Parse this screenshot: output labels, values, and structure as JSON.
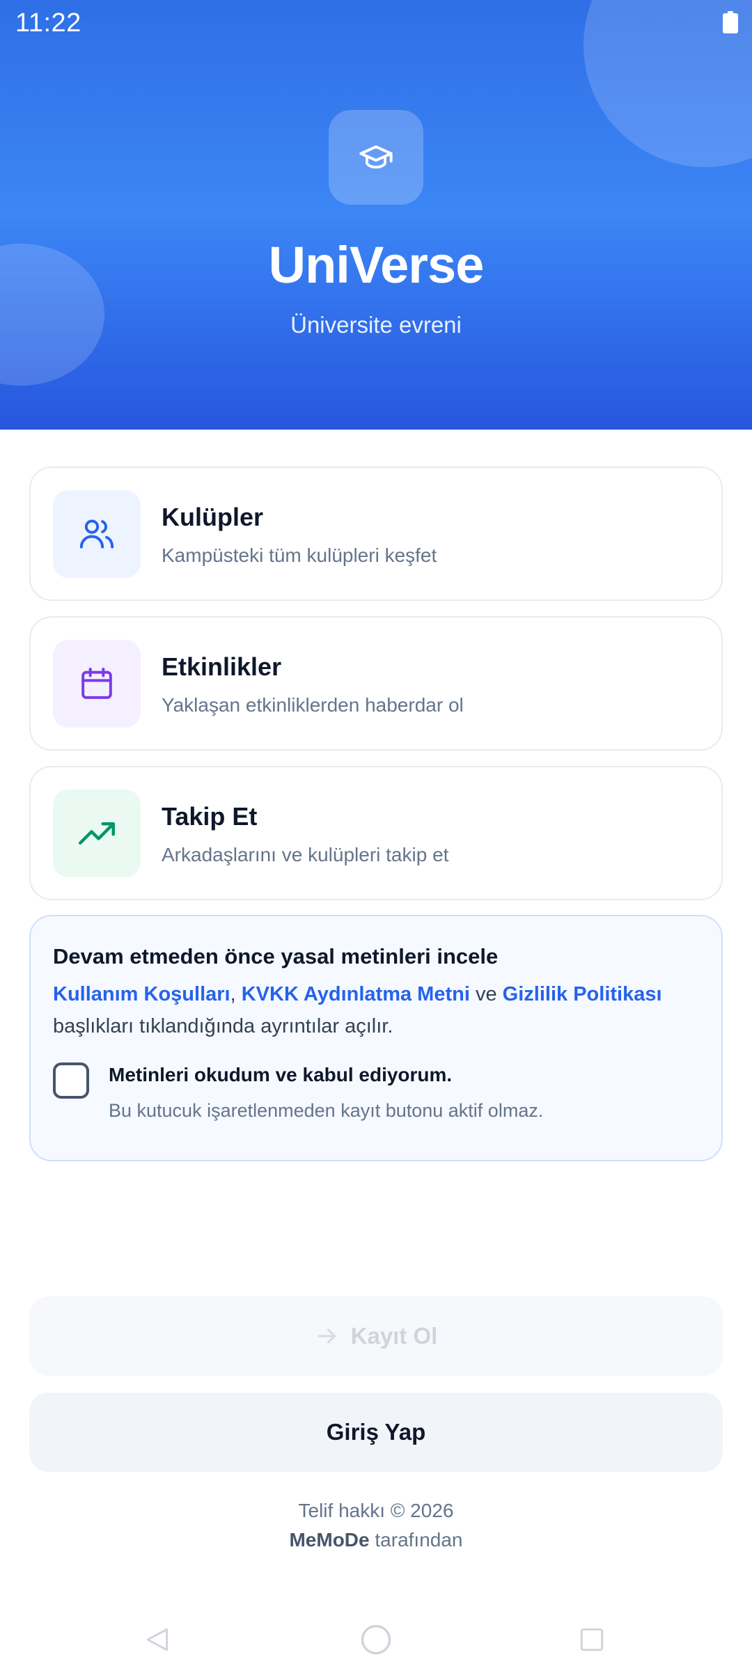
{
  "status_bar": {
    "time": "11:22"
  },
  "hero": {
    "app_name": "UniVerse",
    "tagline": "Üniversite evreni",
    "logo_icon": "graduation-cap-icon",
    "gradient_top": "#2f6fe6",
    "gradient_bottom": "#2656de"
  },
  "features": [
    {
      "title": "Kulüpler",
      "description": "Kampüsteki tüm kulüpleri keşfet",
      "icon": "users-icon",
      "tile_color": "#eef4ff",
      "icon_color": "#2563eb"
    },
    {
      "title": "Etkinlikler",
      "description": "Yaklaşan etkinliklerden haberdar ol",
      "icon": "calendar-icon",
      "tile_color": "#f4f0ff",
      "icon_color": "#7c3aed"
    },
    {
      "title": "Takip Et",
      "description": "Arkadaşlarını ve kulüpleri takip et",
      "icon": "trending-up-icon",
      "tile_color": "#eafaf2",
      "icon_color": "#059669"
    }
  ],
  "legal": {
    "title": "Devam etmeden önce yasal metinleri incele",
    "link_terms": "Kullanım Koşulları",
    "separator": ",",
    "link_kvkk": "KVKK Aydınlatma Metni",
    "conjunction": "ve",
    "link_privacy": "Gizlilik Politikası",
    "note": "başlıkları tıklandığında ayrıntılar açılır.",
    "checkbox_label": "Metinleri okudum ve kabul ediyorum.",
    "checkbox_help": "Bu kutucuk işaretlenmeden kayıt butonu aktif olmaz.",
    "checked": false
  },
  "buttons": {
    "register_label": "Kayıt Ol",
    "register_enabled": false,
    "login_label": "Giriş Yap"
  },
  "footer": {
    "copyright": "Telif hakkı © 2026",
    "company": "MeMoDe",
    "by_suffix": "tarafından"
  },
  "colors": {
    "accent": "#2563eb",
    "text_primary": "#0f172a",
    "text_secondary": "#64748b"
  }
}
